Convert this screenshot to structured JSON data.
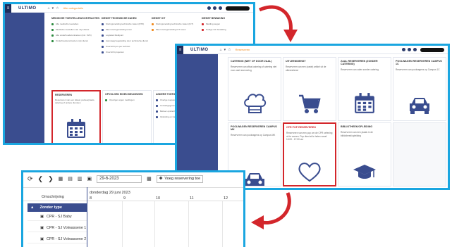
{
  "app": {
    "logo": "ULTIMO",
    "breadcrumb": "Alle categorieën",
    "breadcrumb_short": "Reserveren",
    "menu_icon": "hamburger-icon"
  },
  "screen1": {
    "columns": [
      {
        "title": "MEDISCHE TOESTELLEN/CONTRACTEN",
        "items": [
          "Alle medische toestellen",
          "Medische toestellen van mijn dienst",
          "Alle onderhoudscontracten (incl. KVK)",
          "Onderhoudscontracten mijn dienst"
        ]
      },
      {
        "title": "DIENST TECHNISCHE ZAKEN",
        "items": [
          "Storingsmelding technische zaken (DTZ)",
          "Meer storingsmelding tonen",
          "Logistiek Meldpunt",
          "Aanvraag begeleiding door technische dienst",
          "Overzicht pcs per technici",
          "Overzicht projecten"
        ]
      },
      {
        "title": "DIENST ICT",
        "items": [
          "Storingsmelding technische zaken (ICT)",
          "Meer storingsmelding ICT tonen"
        ]
      },
      {
        "title": "DIENST BEWAKING",
        "items": [
          "Melding wegen",
          "Nuttige info bewaking"
        ]
      }
    ],
    "cards": [
      {
        "title": "RESERVEREN",
        "text": "Reserveren van een lokaal, parkeerplaats, catering of andere diensten",
        "highlight": true
      },
      {
        "title": "OPVOLGEN EIGEN MELDINGEN",
        "items": [
          "Opvolgen eigen meldingen"
        ]
      },
      {
        "title": "ANDERE TOEPASSINGEN",
        "items": [
          "Overige toepassingen",
          "Contactgegevens",
          "Beheer opdrachten",
          "Opleiding en training"
        ]
      },
      {
        "title": "",
        "items": []
      }
    ]
  },
  "screen2": {
    "cards": [
      {
        "title": "CATERING (NIET OF DOOR ZAAL)",
        "text": "Reserveren van aftaal catering of catering niet voor zaal reservering",
        "icon": "chef-hat-icon"
      },
      {
        "title": "UITLEENDIENST",
        "text": "Reserveren van een (vaste) artikel uit de uitleendienst",
        "icon": "shopping-cart-icon"
      },
      {
        "title": "ZAAL RESERVEREN (ZONDER CATERING)",
        "text": "Reserveren van zalen zonder catering",
        "icon": "calendar-icon"
      },
      {
        "title": "POOLWAGEN RESERVEREN CAMPUS 1C",
        "text": "Reserveren van poolwagens op Campus 1C",
        "icon": "car-icon"
      },
      {
        "title": "POOLWAGEN RESERVEREN CAMPUS MK",
        "text": "Reserveren van poolwagens op Campus MK",
        "icon": "car-icon"
      },
      {
        "title": "CPR POP RESERVEREN",
        "text": "Reserveren van een pop om de CPR oefening uit te voeren. Pop dient af te halen vanaf 13:00 - 17:00 uur",
        "icon": "heart-icon",
        "highlight": true
      },
      {
        "title": "BIBLIOTHEEK/OPLEIDING",
        "text": "Reserveren van een plaats in de bibliotheek/opleiding",
        "icon": "graduation-cap-icon"
      },
      {
        "title": "",
        "text": "",
        "icon": ""
      }
    ]
  },
  "screen3": {
    "toolbar": {
      "date": "29-6-2023",
      "add_label": "Voeg reservering toe"
    },
    "header": {
      "left": "Omschrijving",
      "day": "donderdag 29 juni 2023",
      "hours": [
        "8",
        "9",
        "10",
        "11",
        "12"
      ]
    },
    "group": "Zonder type",
    "resources": [
      "CPR - SJ Baby",
      "CPR - SJ Volwassene 1",
      "CPR - SJ Volwassene 2"
    ]
  },
  "colors": {
    "accent": "#1aa6e0",
    "nav": "#3a4d8f",
    "highlight": "#d3262b",
    "arrow": "#d3262b"
  }
}
